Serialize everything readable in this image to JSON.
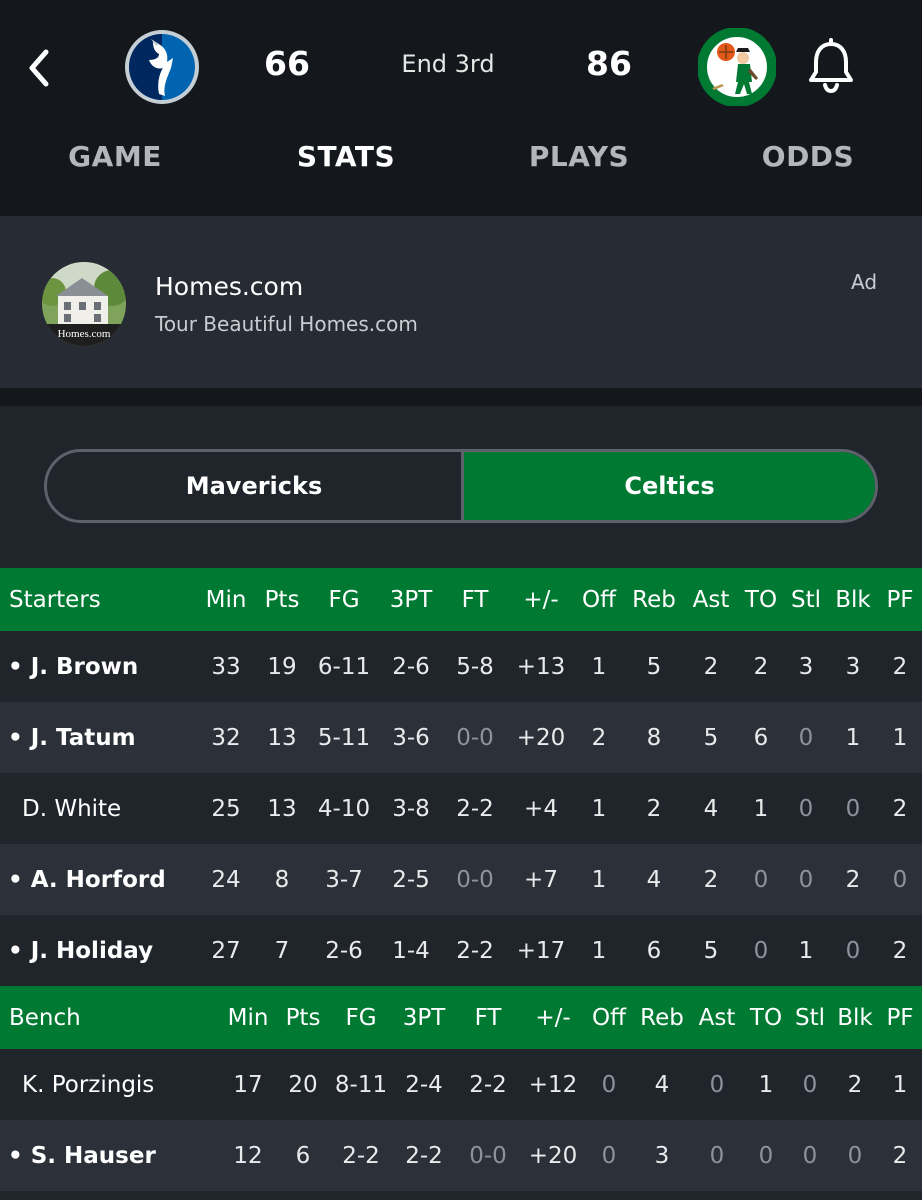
{
  "header": {
    "away_team": "Mavericks",
    "home_team": "Celtics",
    "away_score": "66",
    "home_score": "86",
    "status": "End 3rd",
    "away_logo_icon": "mavericks-logo-icon",
    "home_logo_icon": "celtics-logo-icon",
    "back_icon": "chevron-left-icon",
    "bell_icon": "bell-icon"
  },
  "tabs": [
    {
      "label": "GAME",
      "active": false
    },
    {
      "label": "STATS",
      "active": true
    },
    {
      "label": "PLAYS",
      "active": false
    },
    {
      "label": "ODDS",
      "active": false
    }
  ],
  "ad": {
    "title": "Homes.com",
    "subtitle": "Tour Beautiful Homes.com",
    "tag": "Ad",
    "thumb_text": "Homes.com"
  },
  "team_toggle": {
    "left": "Mavericks",
    "right": "Celtics",
    "selected": "Celtics"
  },
  "colors": {
    "celtics_green": "#007a33",
    "background": "#20242b",
    "row_alt": "#2c3038",
    "topbar": "#14171b"
  },
  "stat_columns": [
    "Min",
    "Pts",
    "FG",
    "3PT",
    "FT",
    "+/-",
    "Off",
    "Reb",
    "Ast",
    "TO",
    "Stl",
    "Blk",
    "PF"
  ],
  "starters": {
    "title": "Starters",
    "players": [
      {
        "name": "• J. Brown",
        "bold": true,
        "stats": [
          "33",
          "19",
          "6-11",
          "2-6",
          "5-8",
          "+13",
          "1",
          "5",
          "2",
          "2",
          "3",
          "3",
          "2"
        ]
      },
      {
        "name": "• J. Tatum",
        "bold": true,
        "stats": [
          "32",
          "13",
          "5-11",
          "3-6",
          "0-0",
          "+20",
          "2",
          "8",
          "5",
          "6",
          "0",
          "1",
          "1"
        ]
      },
      {
        "name": "D. White",
        "bold": false,
        "stats": [
          "25",
          "13",
          "4-10",
          "3-8",
          "2-2",
          "+4",
          "1",
          "2",
          "4",
          "1",
          "0",
          "0",
          "2"
        ]
      },
      {
        "name": "• A. Horford",
        "bold": true,
        "stats": [
          "24",
          "8",
          "3-7",
          "2-5",
          "0-0",
          "+7",
          "1",
          "4",
          "2",
          "0",
          "0",
          "2",
          "0"
        ]
      },
      {
        "name": "• J. Holiday",
        "bold": true,
        "stats": [
          "27",
          "7",
          "2-6",
          "1-4",
          "2-2",
          "+17",
          "1",
          "6",
          "5",
          "0",
          "1",
          "0",
          "2"
        ]
      }
    ]
  },
  "bench": {
    "title": "Bench",
    "players": [
      {
        "name": "K. Porzingis",
        "bold": false,
        "stats": [
          "17",
          "20",
          "8-11",
          "2-4",
          "2-2",
          "+12",
          "0",
          "4",
          "0",
          "1",
          "0",
          "2",
          "1"
        ]
      },
      {
        "name": "• S. Hauser",
        "bold": true,
        "stats": [
          "12",
          "6",
          "2-2",
          "2-2",
          "0-0",
          "+20",
          "0",
          "3",
          "0",
          "0",
          "0",
          "0",
          "2"
        ]
      }
    ]
  }
}
